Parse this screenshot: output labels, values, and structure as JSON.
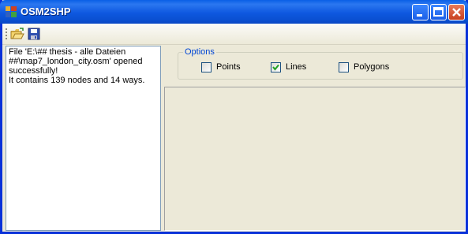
{
  "window": {
    "title": "OSM2SHP"
  },
  "toolbar": {
    "icons": [
      "open-folder-icon",
      "save-icon"
    ]
  },
  "log": {
    "text": "File 'E:\\## thesis - alle Dateien\n##\\map7_london_city.osm' opened\nsuccessfully!\nIt contains 139 nodes and 14 ways."
  },
  "options": {
    "legend": "Options",
    "items": [
      {
        "label": "Points",
        "checked": false
      },
      {
        "label": "Lines",
        "checked": true
      },
      {
        "label": "Polygons",
        "checked": false
      }
    ]
  },
  "colors": {
    "titlebar": "#0a5fe6",
    "accent": "#0046d5",
    "close": "#c8401e"
  }
}
